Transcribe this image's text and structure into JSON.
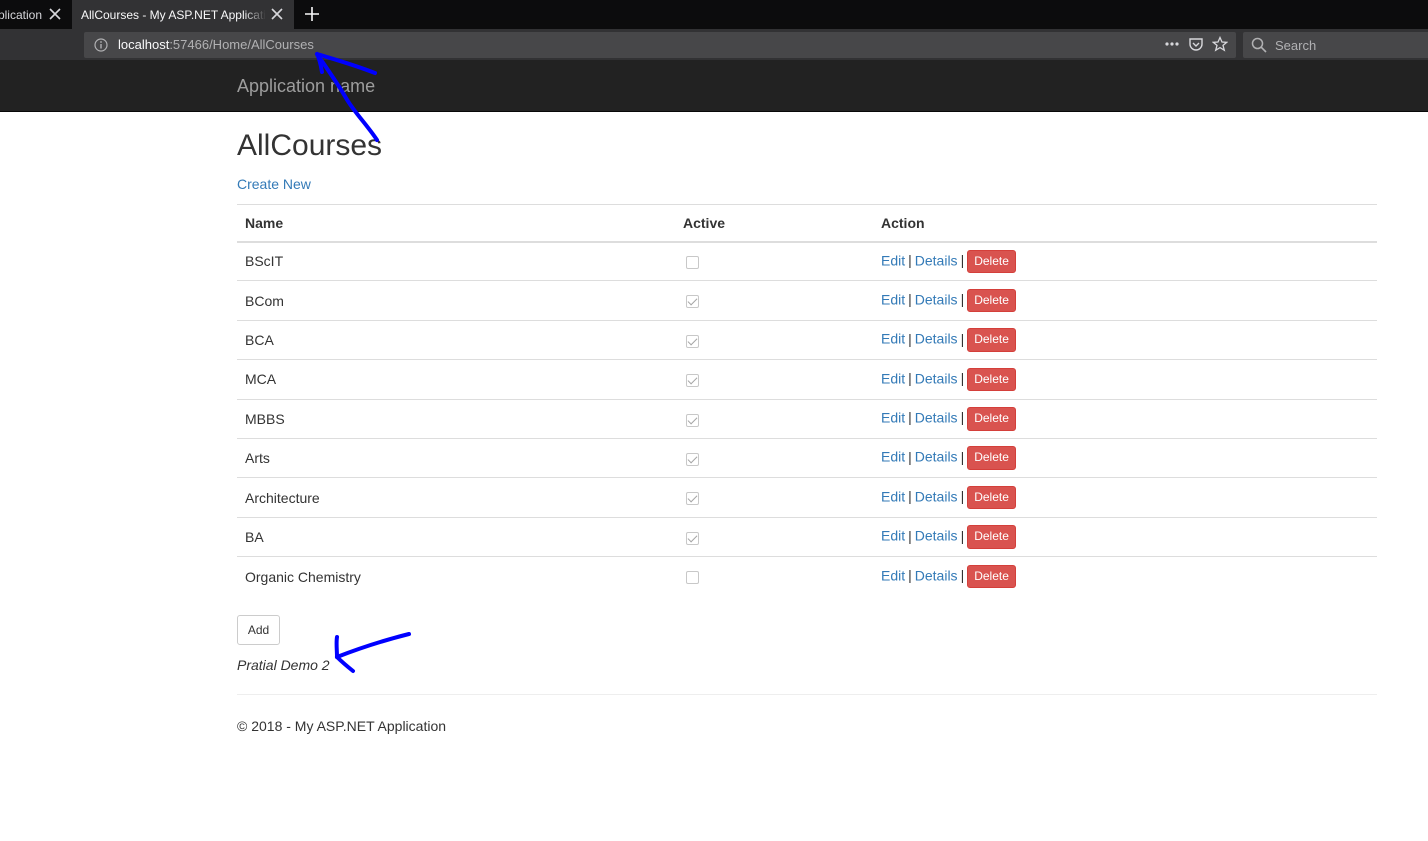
{
  "browser": {
    "tabs": [
      {
        "title": "Application name - My ASP.NET Application",
        "active": false
      },
      {
        "title": "AllCourses - My ASP.NET Application",
        "active": true
      }
    ],
    "url_host": "localhost",
    "url_path": ":57466/Home/AllCourses",
    "search_placeholder": "Search"
  },
  "navbar": {
    "brand": "Application name"
  },
  "page": {
    "title": "AllCourses",
    "create_link": "Create New",
    "columns": {
      "name": "Name",
      "active": "Active",
      "action": "Action"
    },
    "actions": {
      "edit": "Edit",
      "details": "Details",
      "delete": "Delete",
      "separator": "|"
    },
    "courses": [
      {
        "name": "BScIT",
        "active": false
      },
      {
        "name": "BCom",
        "active": true
      },
      {
        "name": "BCA",
        "active": true
      },
      {
        "name": "MCA",
        "active": true
      },
      {
        "name": "MBBS",
        "active": true
      },
      {
        "name": "Arts",
        "active": true
      },
      {
        "name": "Architecture",
        "active": true
      },
      {
        "name": "BA",
        "active": true
      },
      {
        "name": "Organic Chemistry",
        "active": false
      }
    ],
    "add_button": "Add",
    "partial_text": "Pratial Demo 2",
    "footer": "© 2018 - My ASP.NET Application"
  },
  "colors": {
    "link": "#337ab7",
    "danger": "#d9534f",
    "navbar": "#222222",
    "annotation": "#0000ff"
  }
}
